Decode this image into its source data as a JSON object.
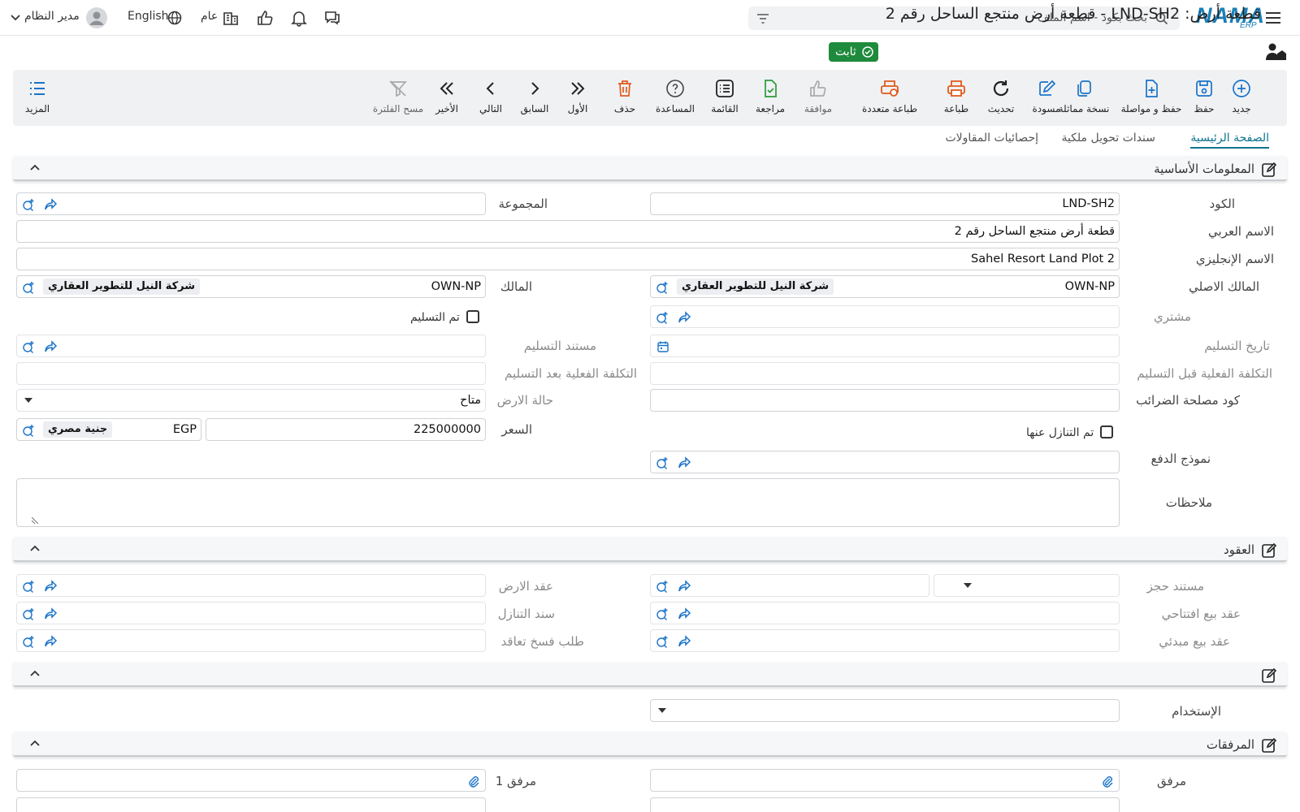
{
  "app": {
    "logo": "NAMA",
    "logo_sub": "ERP"
  },
  "topbar": {
    "search_placeholder": "بحث بكود - اسم الملف",
    "user": "مدير النظام",
    "language": "English",
    "scope": "عام"
  },
  "page": {
    "title": "قطعة أرض: LND-SH2 - قطعة أرض منتجع الساحل رقم 2",
    "status": "ثابت"
  },
  "toolbar": {
    "new": "جديد",
    "save": "حفظ",
    "save_continue": "حفظ و مواصلة",
    "duplicate": "نسخة مماثلة",
    "draft": "مسودة",
    "refresh": "تحديث",
    "print": "طباعة",
    "multi_print": "طباعة متعددة",
    "approve": "موافقة",
    "review": "مراجعة",
    "list": "القائمة",
    "help": "المساعدة",
    "delete": "حذف",
    "first": "الأول",
    "previous": "السابق",
    "next": "التالي",
    "last": "الأخير",
    "clear_filter": "مسح الفلترة",
    "more": "المزيد"
  },
  "tabs": [
    "الصفحة الرئيسية",
    "سندات تحويل ملكية",
    "إحصائيات المقاولات"
  ],
  "sections": {
    "basic": "المعلومات الأساسية",
    "contracts": "العقود",
    "usage_section": "",
    "attachments": "المرفقات"
  },
  "labels": {
    "code": "الكود",
    "group": "المجموعة",
    "arabic_name": "الاسم العربي",
    "english_name": "الاسم الإنجليزي",
    "original_owner": "المالك الاصلي",
    "owner": "المالك",
    "buyer": "مشتري",
    "delivered": "تم التسليم",
    "delivery_date": "تاريخ التسليم",
    "delivery_doc": "مستند التسليم",
    "actual_cost_before": "التكلفة الفعلية قبل التسليم",
    "actual_cost_after": "التكلفة الفعلية بعد التسليم",
    "tax_code": "كود مصلحة الضرائب",
    "land_status": "حالة الارض",
    "waived": "تم التنازل عنها",
    "price": "السعر",
    "payment_model": "نموذج الدفع",
    "notes": "ملاحظات",
    "reservation_doc": "مستند حجز",
    "land_contract": "عقد الارض",
    "opening_sale_contract": "عقد بيع افتتاحي",
    "waiver_doc": "سند التنازل",
    "preliminary_sale_contract": "عقد بيع مبدئي",
    "termination_request": "طلب فسخ تعاقد",
    "usage": "الإستخدام",
    "attachment": "مرفق",
    "attachment1": "مرفق 1"
  },
  "values": {
    "code": "LND-SH2",
    "arabic_name": "قطعة أرض منتجع الساحل رقم 2",
    "english_name": "Sahel Resort Land Plot 2",
    "original_owner_code": "OWN-NP",
    "original_owner_name": "شركة النيل للتطوير العقاري",
    "owner_code": "OWN-NP",
    "owner_name": "شركة النيل للتطوير العقاري",
    "land_status": "متاح",
    "price": "225000000",
    "currency_code": "EGP",
    "currency_name": "جنية مصري"
  }
}
